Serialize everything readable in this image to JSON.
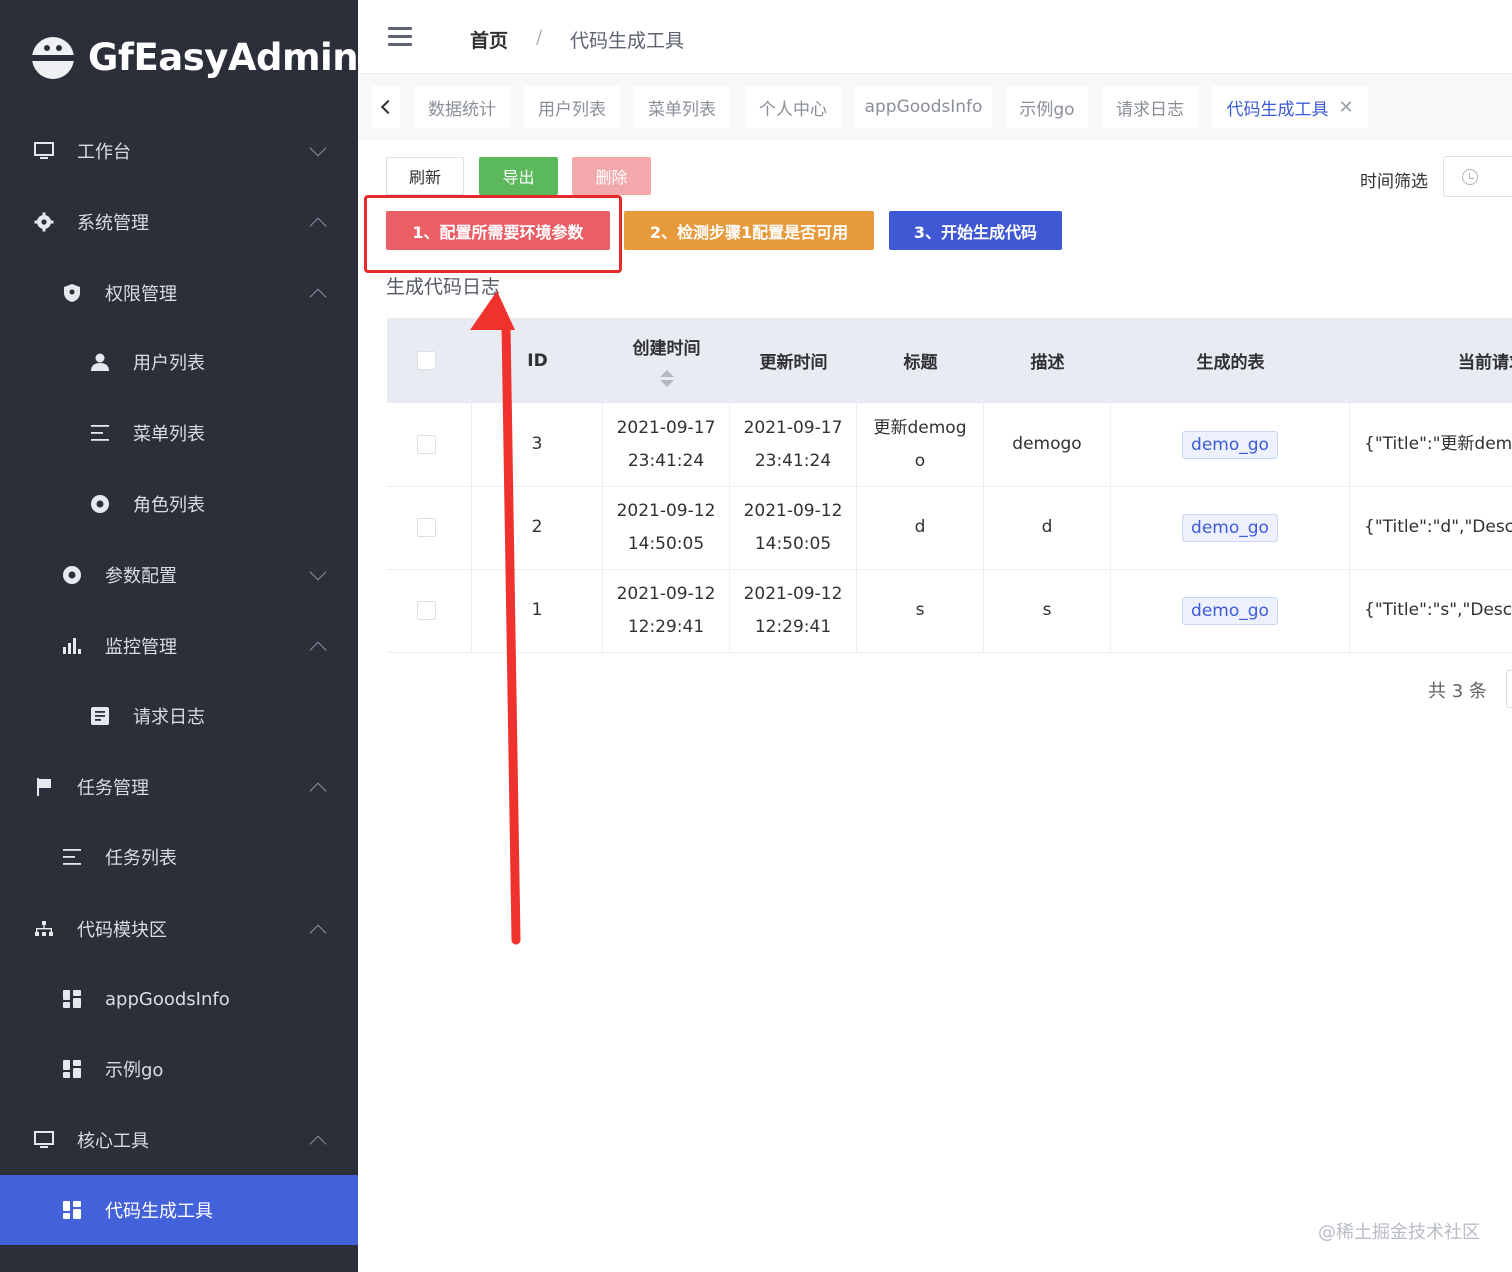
{
  "app": {
    "title": "GfEasyAdmin"
  },
  "sidebar": {
    "items": [
      {
        "label": "工作台",
        "icon": "monitor-icon",
        "state": "collapsed"
      },
      {
        "label": "系统管理",
        "icon": "gear-icon",
        "state": "expanded"
      },
      {
        "label": "权限管理",
        "icon": "shield-icon",
        "state": "expanded"
      },
      {
        "label": "用户列表",
        "icon": "user-icon"
      },
      {
        "label": "菜单列表",
        "icon": "list-icon"
      },
      {
        "label": "角色列表",
        "icon": "circle-dot-icon"
      },
      {
        "label": "参数配置",
        "icon": "circle-dot-icon",
        "state": "collapsed"
      },
      {
        "label": "监控管理",
        "icon": "bar-chart-icon",
        "state": "expanded"
      },
      {
        "label": "请求日志",
        "icon": "document-icon"
      },
      {
        "label": "任务管理",
        "icon": "flag-icon",
        "state": "expanded"
      },
      {
        "label": "任务列表",
        "icon": "list-icon"
      },
      {
        "label": "代码模块区",
        "icon": "org-chart-icon",
        "state": "expanded"
      },
      {
        "label": "appGoodsInfo",
        "icon": "grid-icon"
      },
      {
        "label": "示例go",
        "icon": "grid-icon"
      },
      {
        "label": "核心工具",
        "icon": "monitor-icon",
        "state": "expanded"
      },
      {
        "label": "代码生成工具",
        "icon": "grid-icon",
        "active": true
      }
    ]
  },
  "breadcrumb": {
    "home": "首页",
    "separator": "/",
    "current": "代码生成工具"
  },
  "tabs": [
    {
      "label": "数据统计"
    },
    {
      "label": "用户列表"
    },
    {
      "label": "菜单列表"
    },
    {
      "label": "个人中心"
    },
    {
      "label": "appGoodsInfo"
    },
    {
      "label": "示例go"
    },
    {
      "label": "请求日志"
    },
    {
      "label": "代码生成工具",
      "active": true,
      "close": "✕"
    }
  ],
  "toolbar": {
    "refresh": "刷新",
    "export": "导出",
    "delete": "删除",
    "time_filter_label": "时间筛选"
  },
  "steps": {
    "step1": "1、配置所需要环境参数",
    "step2": "2、检测步骤1配置是否可用",
    "step3": "3、开始生成代码"
  },
  "section_title": "生成代码日志",
  "table": {
    "headers": {
      "id": "ID",
      "created": "创建时间",
      "updated": "更新时间",
      "title": "标题",
      "desc": "描述",
      "table": "生成的表",
      "current": "当前请求"
    },
    "rows": [
      {
        "id": "3",
        "created_date": "2021-09-17",
        "created_time": "23:41:24",
        "updated_date": "2021-09-17",
        "updated_time": "23:41:24",
        "title_l1": "更新demog",
        "title_l2": "o",
        "desc": "demogo",
        "table": "demo_go",
        "current": "{\"Title\":\"更新demogo\""
      },
      {
        "id": "2",
        "created_date": "2021-09-12",
        "created_time": "14:50:05",
        "updated_date": "2021-09-12",
        "updated_time": "14:50:05",
        "title_l1": "d",
        "title_l2": "",
        "desc": "d",
        "table": "demo_go",
        "current": "{\"Title\":\"d\",\"Description\""
      },
      {
        "id": "1",
        "created_date": "2021-09-12",
        "created_time": "12:29:41",
        "updated_date": "2021-09-12",
        "updated_time": "12:29:41",
        "title_l1": "s",
        "title_l2": "",
        "desc": "s",
        "table": "demo_go",
        "current": "{\"Title\":\"s\",\"Description\""
      }
    ]
  },
  "pagination": {
    "total": "共 3 条"
  },
  "watermark": "@稀土掘金技术社区",
  "colors": {
    "sidebar_bg": "#2b2f3a",
    "active": "#4361d8",
    "step1": "#ea5f66",
    "step2": "#e79a3c",
    "step3": "#3f58d4",
    "annotation": "#e5282a"
  }
}
